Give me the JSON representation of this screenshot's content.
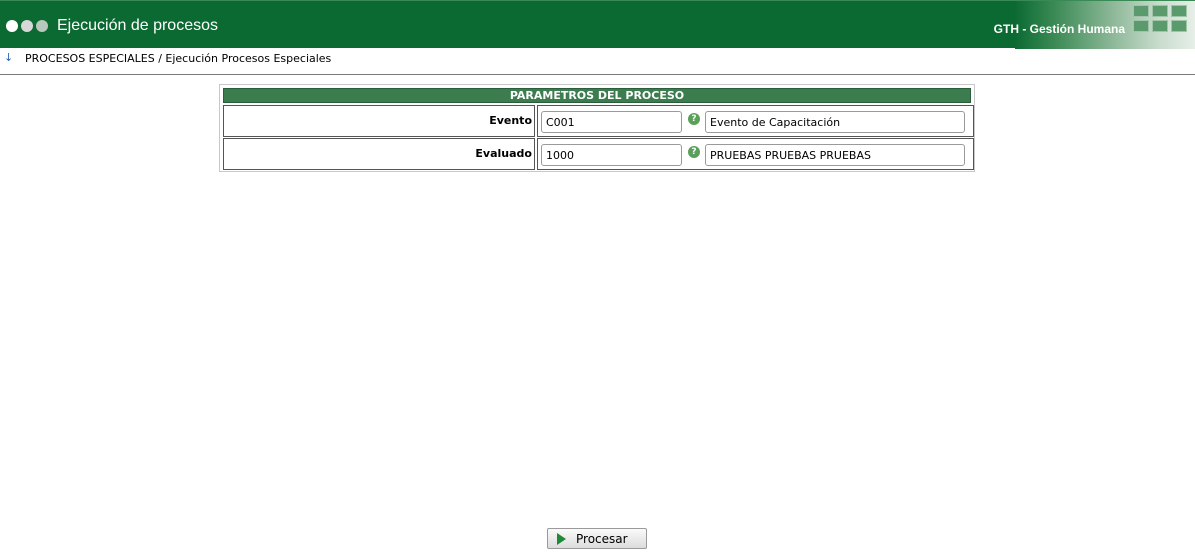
{
  "header": {
    "title": "Ejecución de procesos",
    "brand": "GTH - Gestión Humana",
    "accent_color": "#0b6a32"
  },
  "breadcrumb": {
    "icon": "down-arrow-icon",
    "text": "PROCESOS ESPECIALES / Ejecución Procesos Especiales"
  },
  "params": {
    "title": "PARAMETROS DEL PROCESO",
    "rows": [
      {
        "label": "Evento",
        "code": "C001",
        "help_icon": "help-icon",
        "description": "Evento de Capacitación"
      },
      {
        "label": "Evaluado",
        "code": "1000",
        "help_icon": "help-icon",
        "description": "PRUEBAS PRUEBAS PRUEBAS"
      }
    ]
  },
  "actions": {
    "process_label": "Procesar",
    "process_icon": "play-icon"
  }
}
